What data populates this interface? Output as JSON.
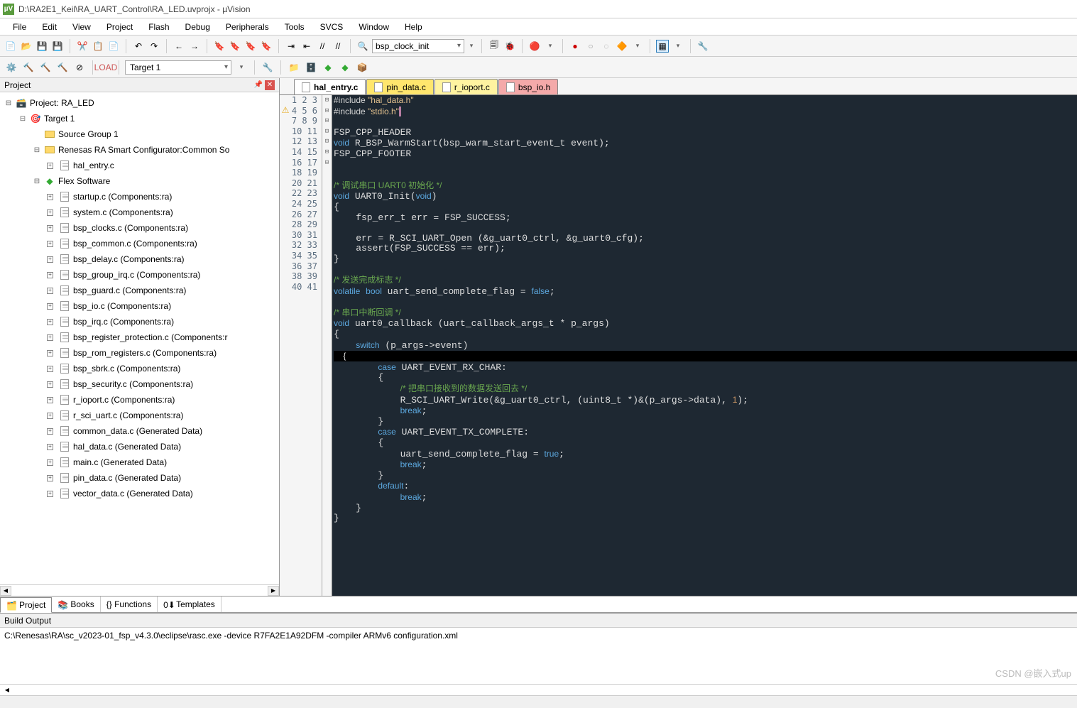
{
  "window": {
    "title": "D:\\RA2E1_Keil\\RA_UART_Control\\RA_LED.uvprojx - µVision"
  },
  "menu": [
    "File",
    "Edit",
    "View",
    "Project",
    "Flash",
    "Debug",
    "Peripherals",
    "Tools",
    "SVCS",
    "Window",
    "Help"
  ],
  "toolbar1": {
    "search_field": "bsp_clock_init"
  },
  "toolbar2": {
    "target_combo": "Target 1"
  },
  "project_panel": {
    "title": "Project",
    "root": "Project: RA_LED",
    "target": "Target 1",
    "groups": [
      {
        "name": "Source Group 1",
        "children": []
      },
      {
        "name": "Renesas RA Smart Configurator:Common So",
        "children": [
          "hal_entry.c"
        ]
      },
      {
        "name": "Flex Software",
        "icon": "diamond",
        "children": [
          "startup.c (Components:ra)",
          "system.c (Components:ra)",
          "bsp_clocks.c (Components:ra)",
          "bsp_common.c (Components:ra)",
          "bsp_delay.c (Components:ra)",
          "bsp_group_irq.c (Components:ra)",
          "bsp_guard.c (Components:ra)",
          "bsp_io.c (Components:ra)",
          "bsp_irq.c (Components:ra)",
          "bsp_register_protection.c (Components:r",
          "bsp_rom_registers.c (Components:ra)",
          "bsp_sbrk.c (Components:ra)",
          "bsp_security.c (Components:ra)",
          "r_ioport.c (Components:ra)",
          "r_sci_uart.c (Components:ra)",
          "common_data.c (Generated Data)",
          "hal_data.c (Generated Data)",
          "main.c (Generated Data)",
          "pin_data.c (Generated Data)",
          "vector_data.c (Generated Data)"
        ]
      }
    ]
  },
  "editor": {
    "tabs": [
      {
        "label": "hal_entry.c",
        "state": "active"
      },
      {
        "label": "pin_data.c",
        "state": "yellow"
      },
      {
        "label": "r_ioport.c",
        "state": "yellow2"
      },
      {
        "label": "bsp_io.h",
        "state": "red"
      }
    ],
    "first_line": 1,
    "last_line": 41,
    "warn_line": 2,
    "highlighted_line": 25
  },
  "bottom_tabs": [
    {
      "label": "Project",
      "active": true
    },
    {
      "label": "Books",
      "active": false
    },
    {
      "label": "{} Functions",
      "active": false
    },
    {
      "label": "Templates",
      "active": false
    }
  ],
  "build_output": {
    "title": "Build Output",
    "text": "C:\\Renesas\\RA\\sc_v2023-01_fsp_v4.3.0\\eclipse\\rasc.exe -device R7FA2E1A92DFM -compiler ARMv6 configuration.xml"
  },
  "watermark": "CSDN @嵌入式up"
}
